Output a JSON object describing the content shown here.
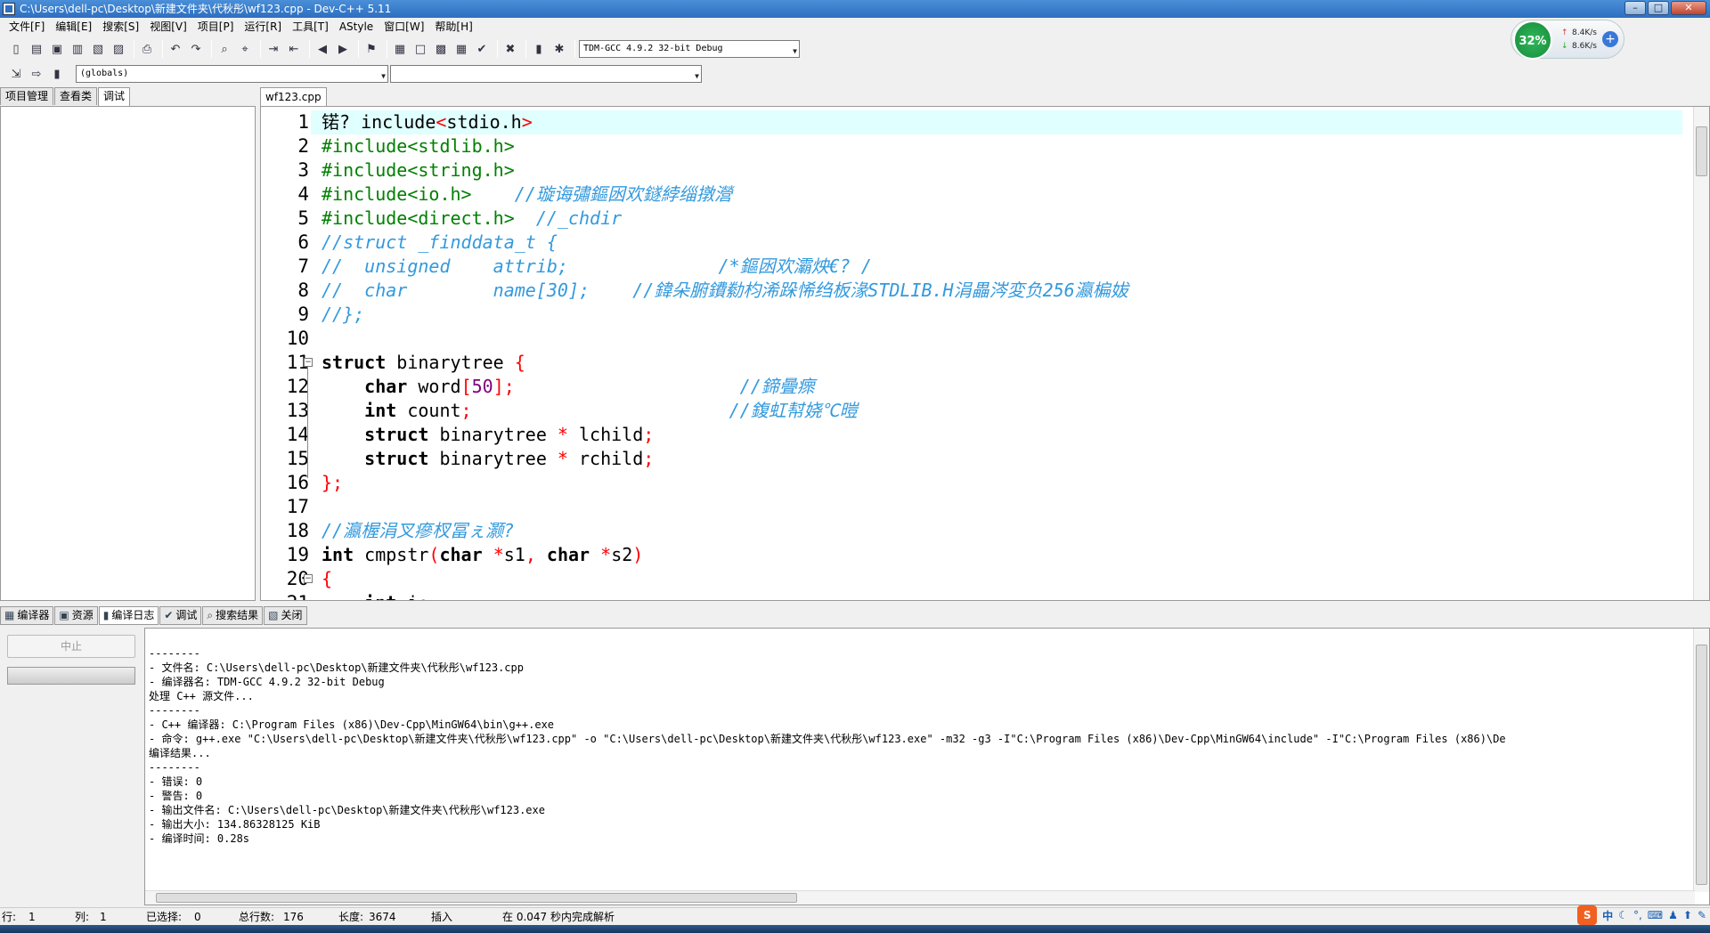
{
  "window": {
    "title": "C:\\Users\\dell-pc\\Desktop\\新建文件夹\\代秋彤\\wf123.cpp - Dev-C++ 5.11"
  },
  "menu": [
    "文件[F]",
    "编辑[E]",
    "搜索[S]",
    "视图[V]",
    "项目[P]",
    "运行[R]",
    "工具[T]",
    "AStyle",
    "窗口[W]",
    "帮助[H]"
  ],
  "toolbar": {
    "compiler": "TDM-GCC 4.9.2 32-bit Debug",
    "scope": "(globals)",
    "member": ""
  },
  "left_tabs": [
    "项目管理",
    "查看类",
    "调试"
  ],
  "editor": {
    "tab": "wf123.cpp",
    "lines": [
      "1",
      "2",
      "3",
      "4",
      "5",
      "6",
      "7",
      "8",
      "9",
      "10",
      "11",
      "12",
      "13",
      "14",
      "15",
      "16",
      "17",
      "18",
      "19",
      "20",
      "21"
    ]
  },
  "bottom_tabs": [
    "编译器",
    "资源",
    "编译日志",
    "调试",
    "搜索结果",
    "关闭"
  ],
  "bottom": {
    "stop_label": "中止"
  },
  "log": [
    "--------",
    "- 文件名: C:\\Users\\dell-pc\\Desktop\\新建文件夹\\代秋彤\\wf123.cpp",
    "- 编译器名: TDM-GCC 4.9.2 32-bit Debug",
    "",
    "处理 C++ 源文件...",
    "--------",
    "- C++ 编译器: C:\\Program Files (x86)\\Dev-Cpp\\MinGW64\\bin\\g++.exe",
    "- 命令: g++.exe \"C:\\Users\\dell-pc\\Desktop\\新建文件夹\\代秋彤\\wf123.cpp\" -o \"C:\\Users\\dell-pc\\Desktop\\新建文件夹\\代秋彤\\wf123.exe\" -m32 -g3 -I\"C:\\Program Files (x86)\\Dev-Cpp\\MinGW64\\include\" -I\"C:\\Program Files (x86)\\De",
    "",
    "编译结果...",
    "--------",
    "- 错误: 0",
    "- 警告: 0",
    "- 输出文件名: C:\\Users\\dell-pc\\Desktop\\新建文件夹\\代秋彤\\wf123.exe",
    "- 输出大小: 134.86328125 KiB",
    "- 编译时间: 0.28s"
  ],
  "status": {
    "row_label": "行:",
    "row": "1",
    "col_label": "列:",
    "col": "1",
    "sel_label": "已选择:",
    "sel": "0",
    "lines_label": "总行数:",
    "lines": "176",
    "len_label": "长度:",
    "len": "3674",
    "mode": "插入",
    "parse": "在 0.047 秒内完成解析"
  },
  "widget": {
    "percent": "32%",
    "up": "8.4K/s",
    "down": "8.6K/s"
  },
  "tray": {
    "ime": "中"
  }
}
